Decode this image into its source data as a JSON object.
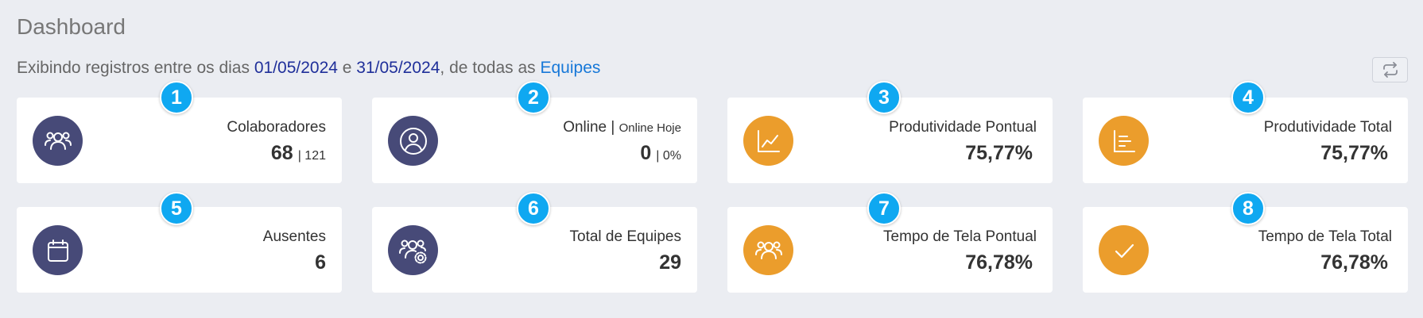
{
  "header": {
    "title": "Dashboard",
    "subtitle_prefix": "Exibindo registros entre os dias ",
    "date_start": "01/05/2024",
    "date_join": " e ",
    "date_end": "31/05/2024",
    "subtitle_middle": ", de todas as ",
    "teams_link": "Equipes",
    "refresh_icon": "refresh-icon"
  },
  "colors": {
    "dark_circle": "#474a78",
    "orange_circle": "#eb9d2c",
    "badge": "#0fa8f1",
    "date_link": "#1f2f9a",
    "teams_link": "#1778d8"
  },
  "cards": [
    {
      "badge": "1",
      "label": "Colaboradores",
      "value": "68",
      "secondary": "| 121",
      "icon": "users-icon"
    },
    {
      "badge": "2",
      "label": "Online |",
      "label_sub": "Online Hoje",
      "value": "0",
      "secondary": "| 0%",
      "icon": "user-circle-icon"
    },
    {
      "badge": "3",
      "label": "Produtividade Pontual",
      "value": "75,77%",
      "icon": "line-chart-icon"
    },
    {
      "badge": "4",
      "label": "Produtividade Total",
      "value": "75,77%",
      "icon": "bar-list-icon"
    },
    {
      "badge": "5",
      "label": "Ausentes",
      "value": "6",
      "icon": "calendar-icon"
    },
    {
      "badge": "6",
      "label": "Total de Equipes",
      "value": "29",
      "icon": "team-settings-icon"
    },
    {
      "badge": "7",
      "label": "Tempo de Tela Pontual",
      "value": "76,78%",
      "icon": "users-icon"
    },
    {
      "badge": "8",
      "label": "Tempo de Tela Total",
      "value": "76,78%",
      "icon": "check-icon"
    }
  ]
}
